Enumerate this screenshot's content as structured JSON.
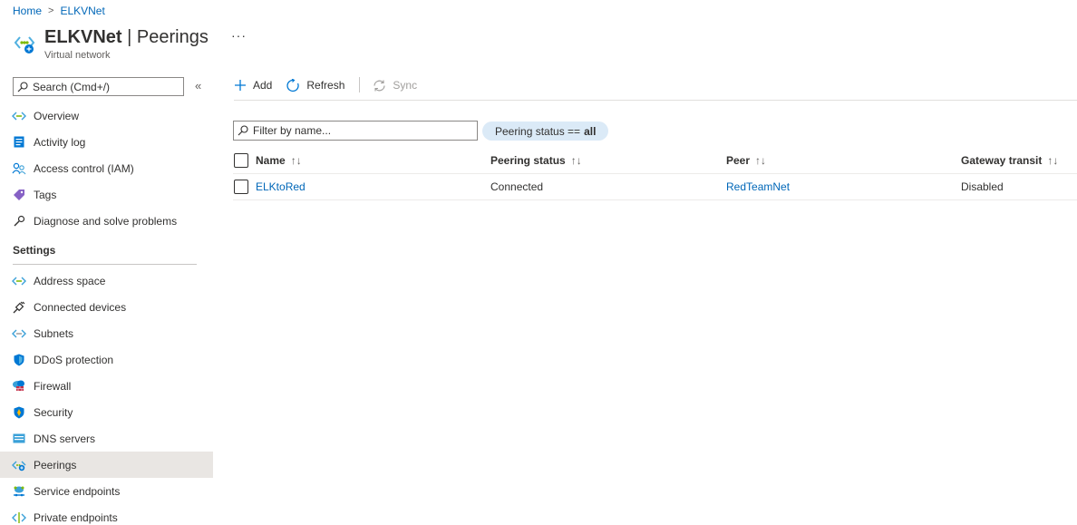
{
  "breadcrumb": {
    "home": "Home",
    "separator": ">",
    "current": "ELKVNet"
  },
  "header": {
    "resource": "ELKVNet",
    "divider": " | ",
    "blade": "Peerings",
    "subtitle": "Virtual network",
    "more": "···"
  },
  "sidebar": {
    "search_placeholder": "Search (Cmd+/)",
    "collapse": "«",
    "items_top": [
      {
        "label": "Overview",
        "icon": "vnet-icon"
      },
      {
        "label": "Activity log",
        "icon": "activity-log-icon"
      },
      {
        "label": "Access control (IAM)",
        "icon": "people-icon"
      },
      {
        "label": "Tags",
        "icon": "tag-icon"
      },
      {
        "label": "Diagnose and solve problems",
        "icon": "wrench-icon"
      }
    ],
    "settings_header": "Settings",
    "items_settings": [
      {
        "label": "Address space",
        "icon": "vnet-icon"
      },
      {
        "label": "Connected devices",
        "icon": "plug-icon"
      },
      {
        "label": "Subnets",
        "icon": "vnet-icon"
      },
      {
        "label": "DDoS protection",
        "icon": "shield-icon"
      },
      {
        "label": "Firewall",
        "icon": "firewall-icon"
      },
      {
        "label": "Security",
        "icon": "security-shield-icon"
      },
      {
        "label": "DNS servers",
        "icon": "dns-icon"
      },
      {
        "label": "Peerings",
        "icon": "peering-icon",
        "active": true
      },
      {
        "label": "Service endpoints",
        "icon": "service-endpoints-icon"
      },
      {
        "label": "Private endpoints",
        "icon": "private-endpoints-icon"
      }
    ]
  },
  "toolbar": {
    "add": "Add",
    "refresh": "Refresh",
    "sync": "Sync"
  },
  "filter": {
    "placeholder": "Filter by name...",
    "pill_prefix": "Peering status ==",
    "pill_value": "all"
  },
  "table": {
    "columns": [
      "Name",
      "Peering status",
      "Peer",
      "Gateway transit"
    ],
    "sort_glyph": "↑↓",
    "rows": [
      {
        "name": "ELKtoRed",
        "status": "Connected",
        "peer": "RedTeamNet",
        "gateway_transit": "Disabled"
      }
    ]
  },
  "colors": {
    "link": "#0067b8",
    "active_bg": "#e9e6e3",
    "pill_bg": "#dbeaf7",
    "accent": "#0078d4"
  }
}
